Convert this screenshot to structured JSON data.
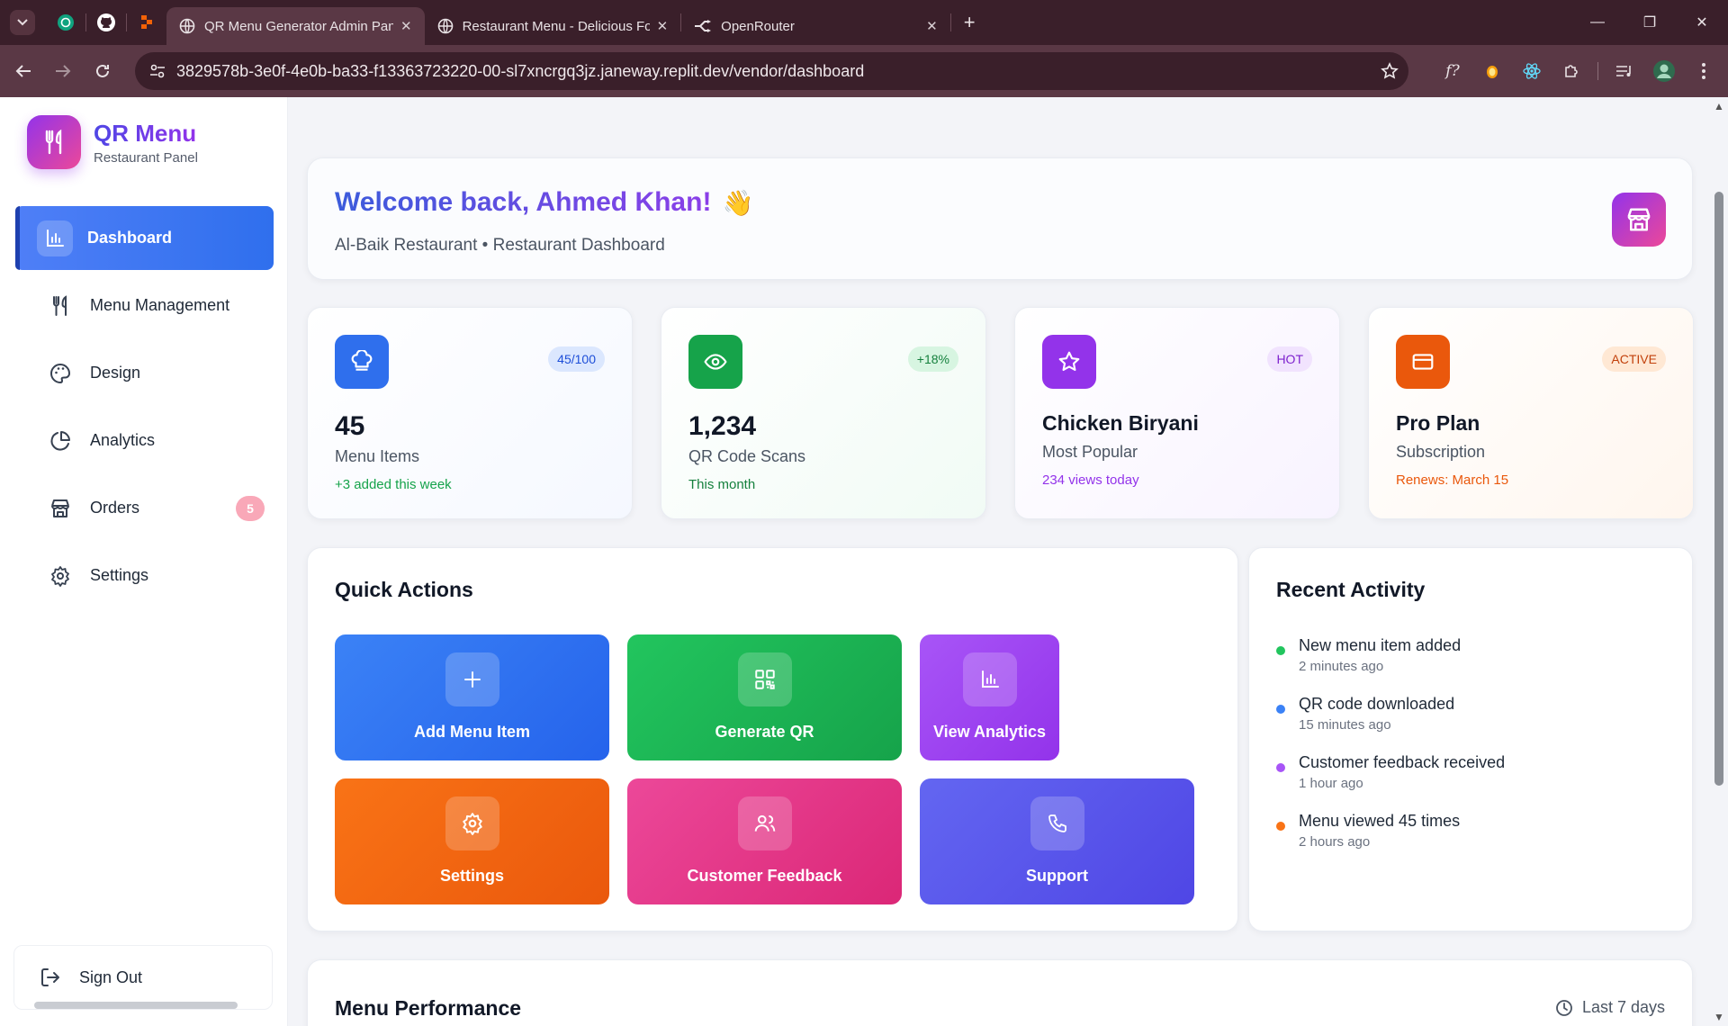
{
  "browser": {
    "tabs": [
      {
        "title": "QR Menu Generator Admin Panel",
        "active": true
      },
      {
        "title": "Restaurant Menu - Delicious Food",
        "active": false
      },
      {
        "title": "OpenRouter",
        "active": false
      }
    ],
    "url": "3829578b-3e0f-4e0b-ba33-f13363723220-00-sl7xncrgq3jz.janeway.replit.dev/vendor/dashboard"
  },
  "sidebar": {
    "brand_title": "QR Menu",
    "brand_subtitle": "Restaurant Panel",
    "items": [
      {
        "label": "Dashboard",
        "icon": "bar-chart-icon",
        "active": true
      },
      {
        "label": "Menu Management",
        "icon": "utensils-icon"
      },
      {
        "label": "Design",
        "icon": "palette-icon"
      },
      {
        "label": "Analytics",
        "icon": "pie-chart-icon"
      },
      {
        "label": "Orders",
        "icon": "store-icon",
        "badge": "5"
      },
      {
        "label": "Settings",
        "icon": "gear-icon"
      }
    ],
    "sign_out": "Sign Out"
  },
  "welcome": {
    "title": "Welcome back, Ahmed Khan!",
    "emoji": "👋",
    "subtitle": "Al-Baik Restaurant • Restaurant Dashboard"
  },
  "stats": [
    {
      "value": "45",
      "label": "Menu Items",
      "badge": "45/100",
      "footer": "+3 added this week",
      "accent": "#2563eb"
    },
    {
      "value": "1,234",
      "label": "QR Code Scans",
      "badge": "+18%",
      "footer": "This month",
      "accent": "#16a34a"
    },
    {
      "value": "Chicken Biryani",
      "label": "Most Popular",
      "badge": "HOT",
      "footer": "234 views today",
      "accent": "#9333ea"
    },
    {
      "value": "Pro Plan",
      "label": "Subscription",
      "badge": "ACTIVE",
      "footer": "Renews: March 15",
      "accent": "#ea580c"
    }
  ],
  "quick_actions": {
    "title": "Quick Actions",
    "items": [
      {
        "label": "Add Menu Item",
        "icon": "plus-icon"
      },
      {
        "label": "Generate QR",
        "icon": "qr-code-icon"
      },
      {
        "label": "View Analytics",
        "icon": "bar-chart-icon"
      },
      {
        "label": "Settings",
        "icon": "gear-icon"
      },
      {
        "label": "Customer Feedback",
        "icon": "users-icon"
      },
      {
        "label": "Support",
        "icon": "phone-icon"
      }
    ]
  },
  "recent_activity": {
    "title": "Recent Activity",
    "items": [
      {
        "title": "New menu item added",
        "time": "2 minutes ago",
        "color": "#22c55e"
      },
      {
        "title": "QR code downloaded",
        "time": "15 minutes ago",
        "color": "#3b82f6"
      },
      {
        "title": "Customer feedback received",
        "time": "1 hour ago",
        "color": "#a855f7"
      },
      {
        "title": "Menu viewed 45 times",
        "time": "2 hours ago",
        "color": "#f97316"
      }
    ]
  },
  "performance": {
    "title": "Menu Performance",
    "range": "Last 7 days"
  }
}
